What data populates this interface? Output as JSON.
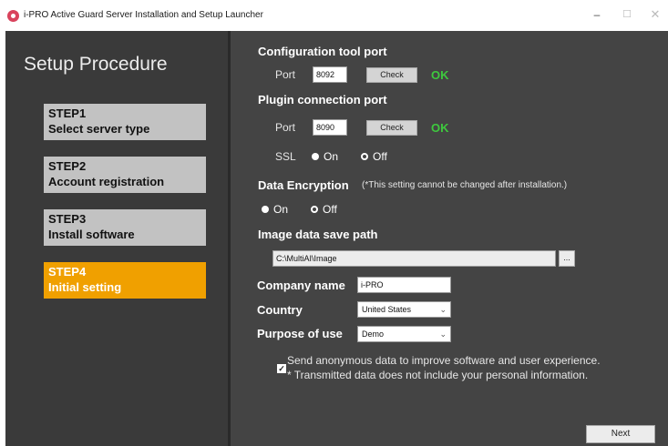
{
  "window": {
    "title": "i-PRO Active Guard Server Installation and Setup Launcher",
    "icon": "ipro-logo-icon",
    "minimize": "–",
    "maximize": "☐",
    "close": "✕"
  },
  "sidebar": {
    "title": "Setup Procedure",
    "steps": [
      {
        "step": "STEP1",
        "label": "Select server type",
        "active": false
      },
      {
        "step": "STEP2",
        "label": "Account registration",
        "active": false
      },
      {
        "step": "STEP3",
        "label": "Install software",
        "active": false
      },
      {
        "step": "STEP4",
        "label": "Initial setting",
        "active": true
      }
    ]
  },
  "config_port": {
    "heading": "Configuration tool port",
    "port_label": "Port",
    "port_value": "8092",
    "check_label": "Check",
    "status": "OK"
  },
  "plugin_port": {
    "heading": "Plugin connection port",
    "port_label": "Port",
    "port_value": "8090",
    "check_label": "Check",
    "status": "OK",
    "ssl_label": "SSL",
    "ssl_on": "On",
    "ssl_off": "Off",
    "ssl_selected": "On"
  },
  "encryption": {
    "heading": "Data Encryption",
    "note": "(*This setting cannot be changed after installation.)",
    "on_label": "On",
    "off_label": "Off",
    "selected": "On"
  },
  "image_path": {
    "heading": "Image data save path",
    "value": "C:\\MultiAI\\Image",
    "browse_label": "..."
  },
  "company": {
    "label": "Company name",
    "value": "i-PRO"
  },
  "country": {
    "label": "Country",
    "value": "United States"
  },
  "purpose": {
    "label": "Purpose of use",
    "value": "Demo"
  },
  "consent": {
    "checked": true,
    "line1": "Send anonymous data to improve software and user experience.",
    "line2": "* Transmitted data does not include your personal information."
  },
  "footer": {
    "next_label": "Next"
  },
  "colors": {
    "sidebar_bg": "#3a3a3a",
    "main_bg": "#444444",
    "step_inactive": "#c2c2c2",
    "step_active": "#f0a000",
    "ok_green": "#3ec93e"
  }
}
